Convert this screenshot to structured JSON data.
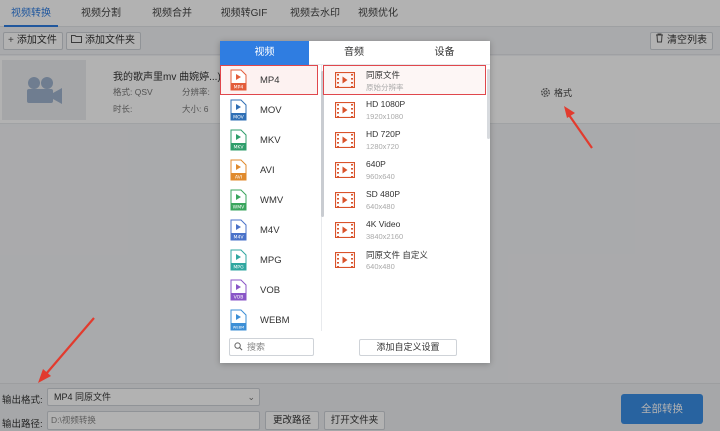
{
  "tabs": [
    "视频转换",
    "视频分割",
    "视频合并",
    "视频转GIF",
    "视频去水印",
    "视频优化"
  ],
  "toolbar": {
    "add_file": "添加文件",
    "add_folder": "添加文件夹",
    "clear_list": "清空列表"
  },
  "file": {
    "name": "我的歌声里mv  曲婉婷...).avi",
    "format_label": "格式: QSV",
    "resolution_label": "分辨率: ",
    "duration_label": "时长: ",
    "size_label": "大小: 6",
    "format_button": "格式"
  },
  "popup": {
    "tabs": [
      "视频",
      "音频",
      "设备"
    ],
    "active_tab": "视频",
    "formats": [
      {
        "name": "MP4",
        "icon_text": "MP4",
        "color": "#e35d3b",
        "selected": true
      },
      {
        "name": "MOV",
        "icon_text": "MOV",
        "color": "#2f6fb5"
      },
      {
        "name": "MKV",
        "icon_text": "MKV",
        "color": "#2f9e6b"
      },
      {
        "name": "AVI",
        "icon_text": "AVI",
        "color": "#e08a2c"
      },
      {
        "name": "WMV",
        "icon_text": "WMV",
        "color": "#3aa55d"
      },
      {
        "name": "M4V",
        "icon_text": "M4V",
        "color": "#4a72c9"
      },
      {
        "name": "MPG",
        "icon_text": "MPG",
        "color": "#30a7a0"
      },
      {
        "name": "VOB",
        "icon_text": "VOB",
        "color": "#8a56c7"
      },
      {
        "name": "WEBM",
        "icon_text": "WEBM",
        "color": "#3c8fd6"
      }
    ],
    "presets": [
      {
        "title": "同原文件",
        "subtitle": "原始分辨率",
        "selected": true
      },
      {
        "title": "HD 1080P",
        "subtitle": "1920x1080"
      },
      {
        "title": "HD 720P",
        "subtitle": "1280x720"
      },
      {
        "title": "640P",
        "subtitle": "960x640"
      },
      {
        "title": "SD 480P",
        "subtitle": "640x480"
      },
      {
        "title": "4K Video",
        "subtitle": "3840x2160"
      },
      {
        "title": "同原文件 自定义",
        "subtitle": "640x480"
      }
    ],
    "search_placeholder": "搜索",
    "add_custom": "添加自定义设置"
  },
  "bottom": {
    "output_format_label": "输出格式:",
    "output_format_value": "MP4  同原文件",
    "output_path_label": "输出路径:",
    "output_path_value": "D:\\视频转换",
    "change_path": "更改路径",
    "open_folder": "打开文件夹",
    "convert_all": "全部转换"
  },
  "colors": {
    "accent": "#2f7de1",
    "highlight": "#e0474c",
    "film_icon": "#d9532b"
  }
}
